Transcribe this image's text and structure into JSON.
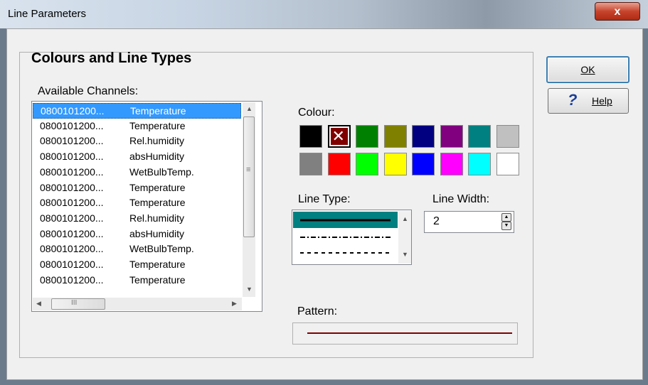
{
  "window": {
    "title": "Line Parameters",
    "close_symbol": "x"
  },
  "heading": "Colours and Line Types",
  "channels": {
    "label": "Available Channels:",
    "items": [
      {
        "id": "0800101200...",
        "name": "Temperature"
      },
      {
        "id": "0800101200...",
        "name": "Temperature"
      },
      {
        "id": "0800101200...",
        "name": "Rel.humidity"
      },
      {
        "id": "0800101200...",
        "name": "absHumidity"
      },
      {
        "id": "0800101200...",
        "name": "WetBulbTemp."
      },
      {
        "id": "0800101200...",
        "name": "Temperature"
      },
      {
        "id": "0800101200...",
        "name": "Temperature"
      },
      {
        "id": "0800101200...",
        "name": "Rel.humidity"
      },
      {
        "id": "0800101200...",
        "name": "absHumidity"
      },
      {
        "id": "0800101200...",
        "name": "WetBulbTemp."
      },
      {
        "id": "0800101200...",
        "name": "Temperature"
      },
      {
        "id": "0800101200...",
        "name": "Temperature"
      }
    ],
    "selected_index": 0,
    "hscroll_thumb_glyph": "III",
    "vscroll_thumb_glyph": "≡"
  },
  "colour": {
    "label": "Colour:",
    "swatches": [
      "#000000",
      "#800000",
      "#008000",
      "#808000",
      "#000080",
      "#800080",
      "#008080",
      "#c0c0c0",
      "#808080",
      "#ff0000",
      "#00ff00",
      "#ffff00",
      "#0000ff",
      "#ff00ff",
      "#00ffff",
      "#ffffff"
    ],
    "selected_index": 1,
    "selected_mark": "✕"
  },
  "line_type": {
    "label": "Line Type:",
    "options": [
      "solid",
      "dash-dot",
      "dashed"
    ],
    "selected_index": 0
  },
  "line_width": {
    "label": "Line Width:",
    "value": "2"
  },
  "pattern": {
    "label": "Pattern:",
    "color": "#800000"
  },
  "buttons": {
    "ok_label": "OK",
    "help_label": "Help",
    "help_mark": "?"
  }
}
